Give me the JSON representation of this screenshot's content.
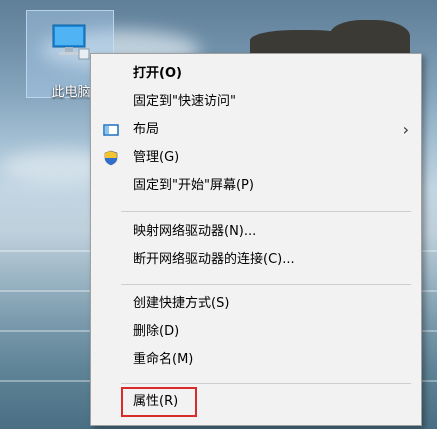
{
  "desktop": {
    "icon_label": "此电脑",
    "icon_name": "computer-monitor-icon"
  },
  "context_menu": {
    "items": [
      {
        "label": "打开(O)",
        "bold": true
      },
      {
        "label": "固定到\"快速访问\""
      },
      {
        "label": "布局",
        "icon": "layout-icon",
        "has_submenu": true,
        "submenu_glyph": "›"
      },
      {
        "label": "管理(G)",
        "icon": "uac-shield-icon"
      },
      {
        "label": "固定到\"开始\"屏幕(P)"
      },
      {
        "label": "映射网络驱动器(N)..."
      },
      {
        "label": "断开网络驱动器的连接(C)..."
      },
      {
        "label": "创建快捷方式(S)"
      },
      {
        "label": "删除(D)"
      },
      {
        "label": "重命名(M)"
      },
      {
        "label": "属性(R)",
        "highlighted": true,
        "highlight_color": "#d92b2b"
      }
    ]
  }
}
